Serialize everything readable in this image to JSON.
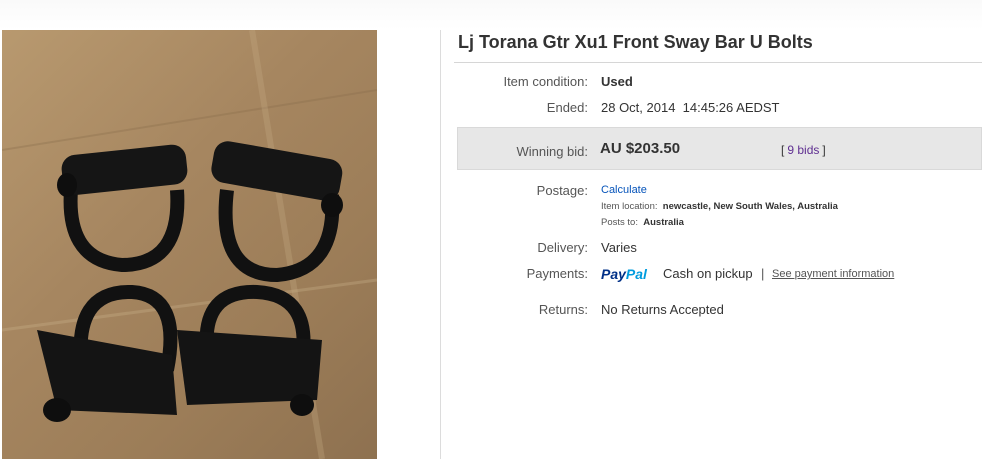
{
  "listing": {
    "title": "Lj Torana Gtr Xu1 Front Sway Bar U Bolts"
  },
  "details": {
    "condition_label": "Item condition:",
    "condition_value": "Used",
    "ended_label": "Ended:",
    "ended_value": "28 Oct, 2014  14:45:26 AEDST",
    "winning_bid_label": "Winning bid:",
    "winning_bid_value": "AU $203.50",
    "bids_open": "[",
    "bids_link": "9 bids",
    "bids_close": "]",
    "postage_label": "Postage:",
    "postage_link": "Calculate",
    "location_label": "Item location:",
    "location_value": "newcastle, New South Wales, Australia",
    "posts_to_label": "Posts to:",
    "posts_to_value": "Australia",
    "delivery_label": "Delivery:",
    "delivery_value": "Varies",
    "payments_label": "Payments:",
    "paypal_part1": "Pay",
    "paypal_part2": "Pal",
    "payment_method": "Cash on pickup",
    "separator": "|",
    "payment_info_link": "See payment information",
    "returns_label": "Returns:",
    "returns_value": "No Returns Accepted"
  },
  "colors": {
    "bid_box_bg": "#e7e7e7",
    "bids_link": "#5f2f91",
    "link_blue": "#0654ba",
    "paypal_dark": "#003087",
    "paypal_light": "#009cde"
  },
  "icons": {
    "paypal_logo": "paypal-logo-icon"
  }
}
